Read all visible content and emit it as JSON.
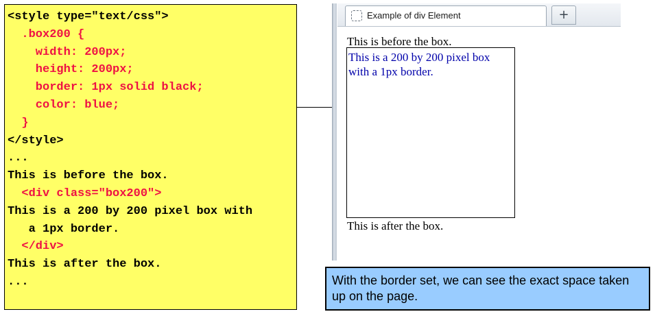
{
  "code_lines": [
    {
      "text": "<style type=\"text/css\">",
      "color": "black"
    },
    {
      "text": "  .box200 {",
      "color": "red"
    },
    {
      "text": "    width: 200px;",
      "color": "red"
    },
    {
      "text": "    height: 200px;",
      "color": "red"
    },
    {
      "text": "    border: 1px solid black;",
      "color": "red"
    },
    {
      "text": "    color: blue;",
      "color": "red"
    },
    {
      "text": "  }",
      "color": "red"
    },
    {
      "text": "</style>",
      "color": "black"
    },
    {
      "text": "...",
      "color": "black"
    },
    {
      "text": "This is before the box.",
      "color": "black"
    },
    {
      "text": "  <div class=\"box200\">",
      "color": "red"
    },
    {
      "text": "This is a 200 by 200 pixel box with",
      "color": "black"
    },
    {
      "text": "   a 1px border.",
      "color": "black"
    },
    {
      "text": "  </div>",
      "color": "red"
    },
    {
      "text": "This is after the box.",
      "color": "black"
    },
    {
      "text": "...",
      "color": "black"
    }
  ],
  "browser": {
    "tab_title": "Example of div Element",
    "new_tab_label": "+",
    "tab_icon": "page-icon",
    "before_text": "This is before the box.",
    "box_text": "This is a 200 by 200 pixel box with a 1px border.",
    "after_text": "This is after the box."
  },
  "note": "With the border set, we can see the exact space taken up on the page.",
  "colors": {
    "code_background": "#ffff66",
    "code_keyword": "#ee1144",
    "box_text": "#0000aa",
    "note_background": "#99ccff"
  }
}
